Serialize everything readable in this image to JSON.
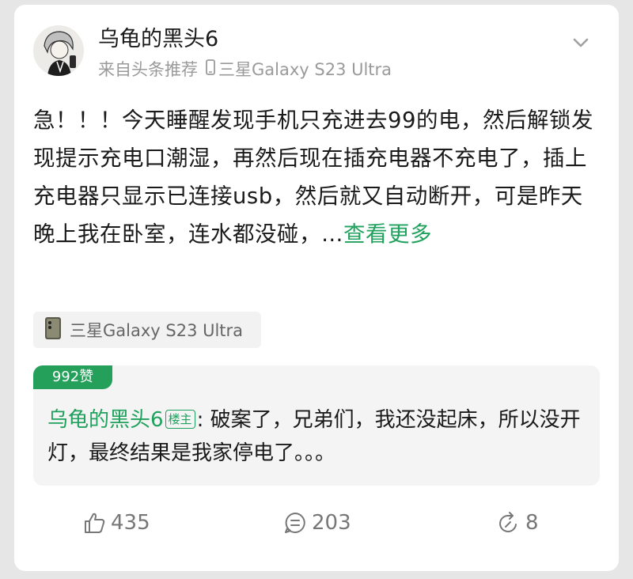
{
  "post": {
    "username": "乌龟的黑头6",
    "source": "来自头条推荐",
    "device": "三星Galaxy S23 Ultra",
    "body_main": "急！！！今天睡醒发现手机只充进去99的电，然后解锁发现提示充电口潮湿，再然后现在插充电器不充电了，插上充电器只显示已连接usb，然后就又自动断开，可是昨天晚上我在卧室，连水都没碰，…",
    "more_label": "查看更多"
  },
  "device_chip": {
    "label": "三星Galaxy S23 Ultra"
  },
  "top_reply": {
    "likes_badge": "992赞",
    "author": "乌龟的黑头6",
    "op_badge": "楼主",
    "text": ": 破案了，兄弟们，我还没起床，所以没开灯，最终结果是我家停电了。。。"
  },
  "actions": {
    "likes": "435",
    "comments": "203",
    "shares": "8"
  },
  "colors": {
    "accent": "#20a15d",
    "badge_bg": "#25a05a"
  }
}
